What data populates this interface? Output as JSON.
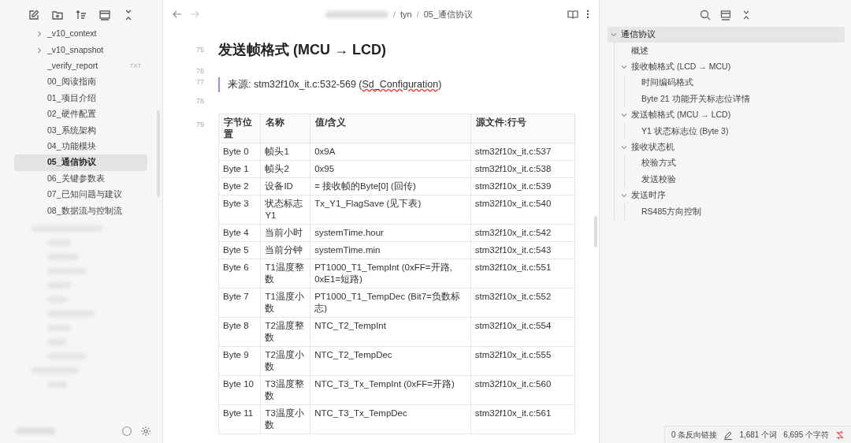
{
  "file_tree": [
    {
      "label": "_v10_context",
      "kind": "folder",
      "expanded": false,
      "selected": false
    },
    {
      "label": "_v10_snapshot",
      "kind": "folder",
      "expanded": false,
      "selected": false
    },
    {
      "label": "_verify_report",
      "kind": "file",
      "badge": "TXT",
      "selected": false
    },
    {
      "label": "00_阅读指南",
      "kind": "file",
      "selected": false
    },
    {
      "label": "01_项目介绍",
      "kind": "file",
      "selected": false
    },
    {
      "label": "02_硬件配置",
      "kind": "file",
      "selected": false
    },
    {
      "label": "03_系统架构",
      "kind": "file",
      "selected": false
    },
    {
      "label": "04_功能模块",
      "kind": "file",
      "selected": false
    },
    {
      "label": "05_通信协议",
      "kind": "file",
      "selected": true
    },
    {
      "label": "06_关键参数表",
      "kind": "file",
      "selected": false
    },
    {
      "label": "07_已知问题与建议",
      "kind": "file",
      "selected": false
    },
    {
      "label": "08_数据流与控制流",
      "kind": "file",
      "selected": false
    }
  ],
  "breadcrumb": [
    {
      "separator": "/",
      "label": "tyn"
    },
    {
      "separator": "/",
      "label": "05_通信协议"
    }
  ],
  "editor": {
    "lines": [
      {
        "number": "75",
        "kind": "heading",
        "text": "发送帧格式 (MCU → LCD)"
      },
      {
        "number": "76",
        "kind": "blank"
      },
      {
        "number": "77",
        "kind": "quote",
        "text": "来源: stm32f10x_it.c:532-569 (",
        "underlined": "Sd_Configuration",
        "after": ")"
      },
      {
        "number": "78",
        "kind": "blank"
      },
      {
        "number": "79",
        "kind": "table"
      }
    ]
  },
  "table": {
    "columns": [
      "字节位置",
      "名称",
      "值/含义",
      "源文件:行号"
    ],
    "rows": [
      [
        "Byte 0",
        "帧头1",
        "0x9A",
        "stm32f10x_it.c:537"
      ],
      [
        "Byte 1",
        "帧头2",
        "0x95",
        "stm32f10x_it.c:538"
      ],
      [
        "Byte 2",
        "设备ID",
        "= 接收帧的Byte[0] (回传)",
        "stm32f10x_it.c:539"
      ],
      [
        "Byte 3",
        "状态标志Y1",
        "Tx_Y1_FlagSave (见下表)",
        "stm32f10x_it.c:540"
      ],
      [
        "Byte 4",
        "当前小时",
        "systemTime.hour",
        "stm32f10x_it.c:542"
      ],
      [
        "Byte 5",
        "当前分钟",
        "systemTime.min",
        "stm32f10x_it.c:543"
      ],
      [
        "Byte 6",
        "T1温度整数",
        "PT1000_T1_TempInt (0xFF=开路, 0xE1=短路)",
        "stm32f10x_it.c:551"
      ],
      [
        "Byte 7",
        "T1温度小数",
        "PT1000_T1_TempDec (Bit7=负数标志)",
        "stm32f10x_it.c:552"
      ],
      [
        "Byte 8",
        "T2温度整数",
        "NTC_T2_TempInt",
        "stm32f10x_it.c:554"
      ],
      [
        "Byte 9",
        "T2温度小数",
        "NTC_T2_TempDec",
        "stm32f10x_it.c:555"
      ],
      [
        "Byte 10",
        "T3温度整数",
        "NTC_T3_Tx_TempInt (0xFF=开路)",
        "stm32f10x_it.c:560"
      ],
      [
        "Byte 11",
        "T3温度小数",
        "NTC_T3_Tx_TempDec",
        "stm32f10x_it.c:561"
      ]
    ]
  },
  "outline": [
    {
      "label": "通信协议",
      "selected": true,
      "expanded": true,
      "children": [
        {
          "label": "概述"
        },
        {
          "label": "接收帧格式 (LCD → MCU)",
          "expanded": true,
          "children": [
            {
              "label": "时间编码格式"
            },
            {
              "label": "Byte 21 功能开关标志位详情"
            }
          ]
        },
        {
          "label": "发送帧格式 (MCU → LCD)",
          "expanded": true,
          "children": [
            {
              "label": "Y1 状态标志位 (Byte 3)"
            }
          ]
        },
        {
          "label": "接收状态机",
          "expanded": true,
          "children": [
            {
              "label": "校验方式"
            },
            {
              "label": "发送校验"
            }
          ]
        },
        {
          "label": "发送时序",
          "expanded": true,
          "children": [
            {
              "label": "RS485方向控制"
            }
          ]
        }
      ]
    }
  ],
  "status_bar": {
    "backlinks": "0 条反向链接",
    "words": "1,681 个词",
    "chars": "6,695 个字符"
  }
}
